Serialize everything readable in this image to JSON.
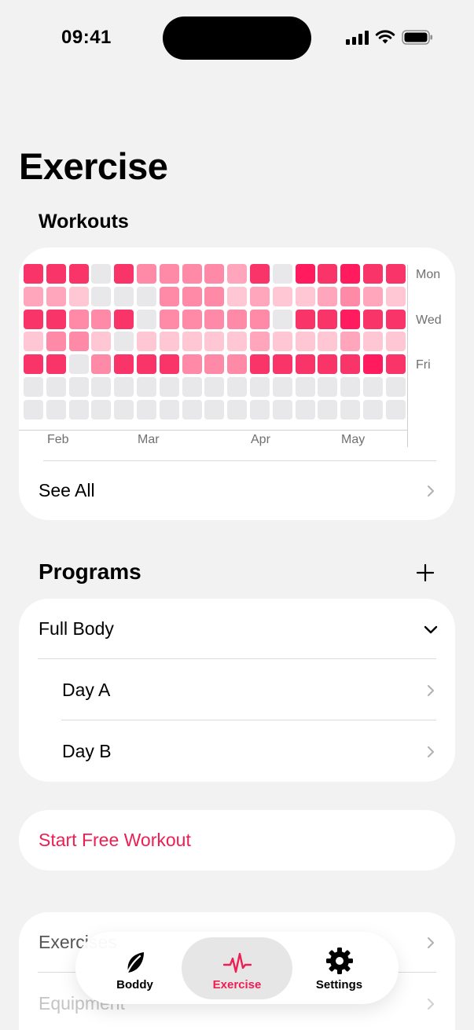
{
  "status_bar": {
    "time": "09:41"
  },
  "page": {
    "title": "Exercise"
  },
  "workouts": {
    "heading": "Workouts",
    "day_labels": [
      "Mon",
      "Wed",
      "Fri"
    ],
    "month_labels": [
      "Feb",
      "Mar",
      "Apr",
      "May"
    ],
    "see_all_label": "See All",
    "level_colors": [
      "#E8E8EA",
      "#FFC7D4",
      "#FFA6BC",
      "#FF8AA8",
      "#FF5783",
      "#F93468",
      "#FF1B5D"
    ],
    "heatmap_levels": [
      [
        5,
        5,
        5,
        0,
        5,
        3,
        3,
        3,
        3,
        2,
        5,
        0,
        6,
        5,
        6,
        5,
        5
      ],
      [
        2,
        2,
        1,
        0,
        0,
        0,
        3,
        3,
        3,
        1,
        2,
        1,
        1,
        2,
        3,
        2,
        1
      ],
      [
        5,
        5,
        3,
        3,
        5,
        0,
        3,
        3,
        3,
        3,
        3,
        0,
        5,
        5,
        6,
        5,
        5
      ],
      [
        1,
        3,
        3,
        1,
        0,
        1,
        1,
        1,
        1,
        1,
        2,
        1,
        1,
        1,
        2,
        1,
        1
      ],
      [
        5,
        5,
        0,
        3,
        5,
        5,
        5,
        3,
        3,
        3,
        5,
        5,
        5,
        5,
        5,
        6,
        5
      ],
      [
        0,
        0,
        0,
        0,
        0,
        0,
        0,
        0,
        0,
        0,
        0,
        0,
        0,
        0,
        0,
        0,
        0
      ],
      [
        0,
        0,
        0,
        0,
        0,
        0,
        0,
        0,
        0,
        0,
        0,
        0,
        0,
        0,
        0,
        0,
        0
      ]
    ]
  },
  "programs": {
    "heading": "Programs",
    "add_icon": "plus-icon",
    "group_label": "Full Body",
    "items": [
      {
        "label": "Day A"
      },
      {
        "label": "Day B"
      }
    ]
  },
  "start_workout": {
    "label": "Start Free Workout",
    "color": "#EE1E52"
  },
  "library": {
    "items": [
      {
        "label": "Exercises"
      },
      {
        "label": "Equipment"
      }
    ]
  },
  "tabbar": {
    "tabs": [
      {
        "label": "Boddy",
        "icon": "leaf-icon",
        "active": false
      },
      {
        "label": "Exercise",
        "icon": "heartbeat-icon",
        "active": true
      },
      {
        "label": "Settings",
        "icon": "gear-icon",
        "active": false
      }
    ]
  }
}
